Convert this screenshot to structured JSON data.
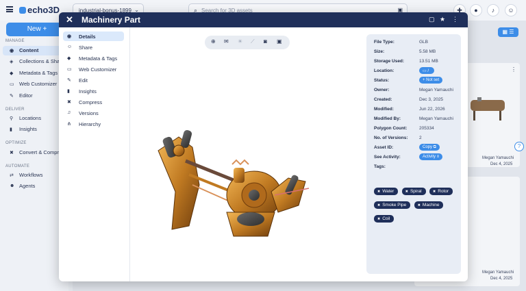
{
  "app": {
    "logo": "echo3D",
    "project_select": "industrial-bonus-1899",
    "search_placeholder": "Search for 3D assets"
  },
  "sidebar": {
    "new_button": "New +",
    "sections": [
      {
        "label": "MANAGE",
        "items": [
          {
            "label": "Content",
            "icon": "cube-icon",
            "active": true
          },
          {
            "label": "Collections & Sharing",
            "icon": "share-icon"
          },
          {
            "label": "Metadata & Tags",
            "icon": "tag-icon"
          },
          {
            "label": "Web Customizer",
            "icon": "vr-icon"
          },
          {
            "label": "Editor",
            "icon": "pen-icon"
          }
        ]
      },
      {
        "label": "DELIVER",
        "items": [
          {
            "label": "Locations",
            "icon": "pin-icon"
          },
          {
            "label": "Insights",
            "icon": "bar-chart-icon"
          }
        ]
      },
      {
        "label": "OPTIMIZE",
        "items": [
          {
            "label": "Convert & Compress",
            "icon": "compress-icon"
          }
        ]
      },
      {
        "label": "AUTOMATE",
        "items": [
          {
            "label": "Workflows",
            "icon": "flow-icon"
          },
          {
            "label": "Agents",
            "icon": "agent-icon"
          }
        ]
      }
    ]
  },
  "cards": [
    {
      "owner": "Megan Yamauchi",
      "date": "Dec 4, 2025"
    },
    {
      "owner": "Megan Yamauchi",
      "date": "Dec 4, 2025"
    }
  ],
  "modal": {
    "title": "Machinery Part",
    "nav": [
      {
        "label": "Details",
        "icon": "globe-icon",
        "active": true
      },
      {
        "label": "Share",
        "icon": "user-plus-icon"
      },
      {
        "label": "Metadata & Tags",
        "icon": "tag-icon"
      },
      {
        "label": "Web Customizer",
        "icon": "vr-icon"
      },
      {
        "label": "Edit",
        "icon": "pen-icon"
      },
      {
        "label": "Insights",
        "icon": "bar-chart-icon"
      },
      {
        "label": "Compress",
        "icon": "compress-icon"
      },
      {
        "label": "Versions",
        "icon": "versions-icon"
      },
      {
        "label": "Hierarchy",
        "icon": "hierarchy-icon"
      }
    ],
    "details": [
      {
        "label": "File Type:",
        "value": "GLB"
      },
      {
        "label": "Size:",
        "value": "5.58 MB"
      },
      {
        "label": "Storage Used:",
        "value": "13.51 MB"
      },
      {
        "label": "Location:",
        "pill": "📍"
      },
      {
        "label": "Status:",
        "pill": "+ Not set"
      },
      {
        "label": "Owner:",
        "value": "Megan Yamauchi"
      },
      {
        "label": "Created:",
        "value": "Dec 3, 2025"
      },
      {
        "label": "Modified:",
        "value": "Jun 22, 2026"
      },
      {
        "label": "Modified By:",
        "value": "Megan Yamauchi"
      },
      {
        "label": "Polygon Count:",
        "value": "205334"
      },
      {
        "label": "No. of Versions:",
        "value": "2"
      },
      {
        "label": "Asset ID:",
        "pill": "Copy"
      },
      {
        "label": "See Activity:",
        "pill": "Activity"
      }
    ],
    "tags_label": "Tags:",
    "tags": [
      "Water",
      "Spiral",
      "Rotor",
      "Smoke Pipe",
      "Machine",
      "Coil"
    ],
    "colors": {
      "header": "#1f2f5a",
      "accent": "#3d8de8",
      "tag": "#1f2f5a"
    }
  }
}
